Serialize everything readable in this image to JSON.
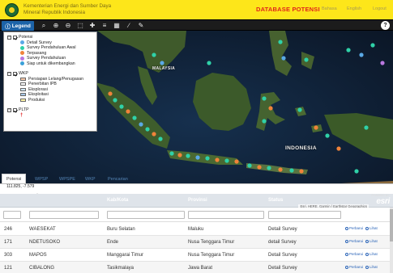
{
  "header": {
    "org_line1": "Kementerian Energi dan Sumber Daya",
    "org_line2": "Mineral Republik Indonesia",
    "title": "DATABASE POTENSI",
    "lang_id": "Bahasa",
    "lang_en": "English",
    "logout": "Logout"
  },
  "toolbar": {
    "legend_label": "Legend",
    "tools": [
      "search-icon",
      "zoom-in-icon",
      "zoom-out-icon",
      "full-extent-icon",
      "pan-icon",
      "layers-icon",
      "basemap-grid-icon",
      "measure-icon",
      "edit-icon"
    ],
    "help_label": "?"
  },
  "legend": {
    "potensi": {
      "title": "Potensi",
      "items": [
        {
          "label": "Detail Survey",
          "color": "#5aa9e6"
        },
        {
          "label": "Survey Pendahuluan Awal",
          "color": "#2fd1a8"
        },
        {
          "label": "Terpasang",
          "color": "#f0833a"
        },
        {
          "label": "Survey Pendahuluan",
          "color": "#b978e0"
        },
        {
          "label": "Siap untuk dikembangkan",
          "color": "#3aa0d8"
        }
      ]
    },
    "wkp": {
      "title": "WKP",
      "items": [
        {
          "label": "Persiapan Lelang/Penugasan",
          "color": "#f7c7a8"
        },
        {
          "label": "Penerbitan IPB",
          "color": "#ffffff"
        },
        {
          "label": "Eksplorasi",
          "color": "#cfe6f5"
        },
        {
          "label": "Eksploitasi",
          "color": "#a9c8e8"
        },
        {
          "label": "Produksi",
          "color": "#fff4a6"
        }
      ]
    },
    "pltp": {
      "title": "PLTP",
      "symbol": "†"
    }
  },
  "map": {
    "labels": {
      "malaysia": "MALAYSIA",
      "indonesia": "INDONESIA"
    },
    "attribution": "Esri, HERE, Garmin | Earthstar Geographics",
    "esri_logo": "esri",
    "powered_by": "POWERED BY"
  },
  "tabs": [
    {
      "label": "Potensi",
      "active": true
    },
    {
      "label": "WPSP",
      "active": false
    },
    {
      "label": "WPSPE",
      "active": false
    },
    {
      "label": "WKP",
      "active": false
    },
    {
      "label": "Pencarian",
      "active": false
    }
  ],
  "coords": "111.825, -7.579",
  "scale": {
    "km": "400km",
    "mi": "300mi"
  },
  "table": {
    "columns": [
      "",
      "",
      "Kab/Kota",
      "Provinsi",
      "Status"
    ],
    "rows": [
      {
        "id": "246",
        "name": "WAESEKAT",
        "kab": "Buru Selatan",
        "prov": "Maluku",
        "status": "Detail Survey"
      },
      {
        "id": "171",
        "name": "NDETUSOKO",
        "kab": "Ende",
        "prov": "Nusa Tenggara Timur",
        "status": "detail Survey"
      },
      {
        "id": "303",
        "name": "MAPOS",
        "kab": "Manggarai Timur",
        "prov": "Nusa Tenggara Timur",
        "status": "Detail Survey"
      },
      {
        "id": "121",
        "name": "CIBALONG",
        "kab": "Tasikmalaya",
        "prov": "Jawa Barat",
        "status": "Detail Survey"
      }
    ],
    "action_edit": "Perbarui",
    "action_view": "Lihat"
  }
}
